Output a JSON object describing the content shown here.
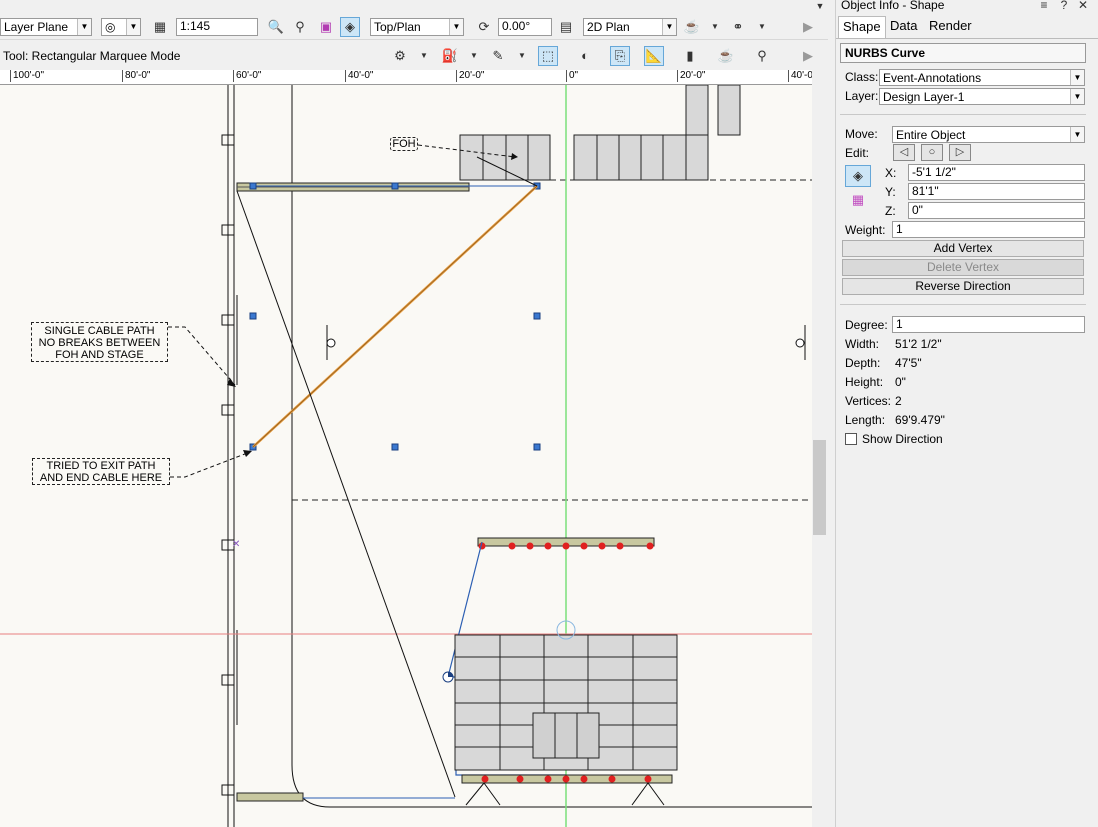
{
  "toolbar": {
    "layer_plane": "Layer Plane",
    "scale": "1:145",
    "view": "Top/Plan",
    "rotation": "0.00°",
    "render_mode": "2D Plan"
  },
  "status": {
    "tool_mode": "Tool: Rectangular Marquee Mode"
  },
  "ruler": {
    "marks": [
      "100'-0\"",
      "80'-0\"",
      "60'-0\"",
      "40'-0\"",
      "20'-0\"",
      "0\"",
      "20'-0\"",
      "40'-0"
    ]
  },
  "drawing": {
    "foh_label": "FOH",
    "callout1": [
      "SINGLE CABLE PATH",
      "NO BREAKS BETWEEN",
      "FOH AND STAGE"
    ],
    "callout2": [
      "TRIED TO EXIT PATH",
      "AND END CABLE HERE"
    ],
    "colors": {
      "nurbs_curve": "#e69a3a",
      "selection": "#2c5fb3",
      "green_axis": "#7be07b",
      "red_axis": "#e88080"
    }
  },
  "panel": {
    "title": "Object Info - Shape",
    "tabs": [
      "Shape",
      "Data",
      "Render"
    ],
    "object_type": "NURBS Curve",
    "class_label": "Class:",
    "class_value": "Event-Annotations",
    "layer_label": "Layer:",
    "layer_value": "Design Layer-1",
    "move_label": "Move:",
    "move_value": "Entire Object",
    "edit_label": "Edit:",
    "x_label": "X:",
    "x_value": "-5'1 1/2\"",
    "y_label": "Y:",
    "y_value": "81'1\"",
    "z_label": "Z:",
    "z_value": "0\"",
    "weight_label": "Weight:",
    "weight_value": "1",
    "add_vertex": "Add Vertex",
    "delete_vertex": "Delete Vertex",
    "reverse_direction": "Reverse Direction",
    "degree_label": "Degree:",
    "degree_value": "1",
    "width_label": "Width:",
    "width_value": "51'2 1/2\"",
    "depth_label": "Depth:",
    "depth_value": "47'5\"",
    "height_label": "Height:",
    "height_value": "0\"",
    "vertices_label": "Vertices:",
    "vertices_value": "2",
    "length_label": "Length:",
    "length_value": "69'9.479\"",
    "show_direction": "Show Direction"
  }
}
